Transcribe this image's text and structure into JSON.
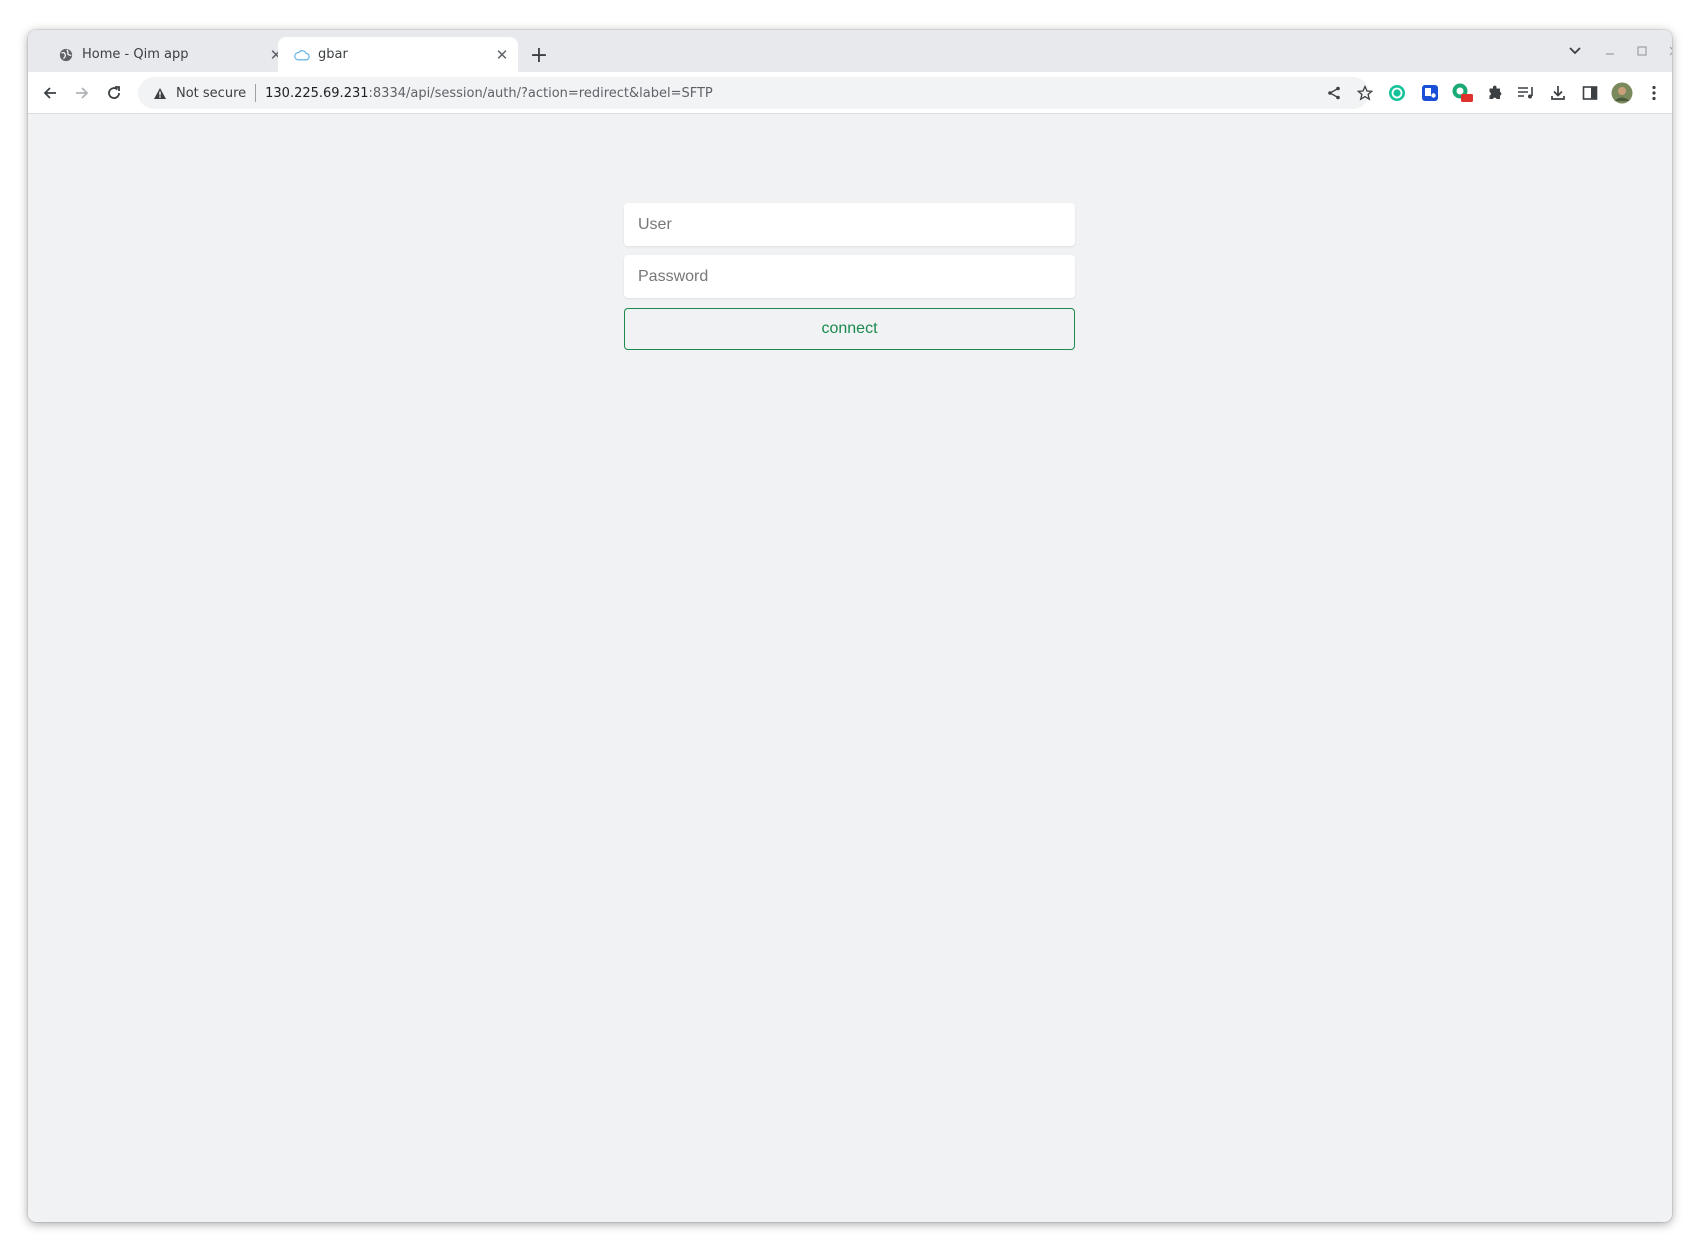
{
  "browser": {
    "tabs": [
      {
        "title": "Home - Qim app",
        "favicon": "globe-icon",
        "active": false
      },
      {
        "title": "gbar",
        "favicon": "cloud-icon",
        "active": true
      }
    ],
    "address": {
      "security_label": "Not secure",
      "host": "130.225.69.231",
      "path": ":8334/api/session/auth/?action=redirect&label=SFTP"
    },
    "extension_badge": "off"
  },
  "login": {
    "user_placeholder": "User",
    "password_placeholder": "Password",
    "connect_label": "connect"
  },
  "colors": {
    "accent": "#1a8a4e",
    "page_background": "#f1f2f4"
  }
}
